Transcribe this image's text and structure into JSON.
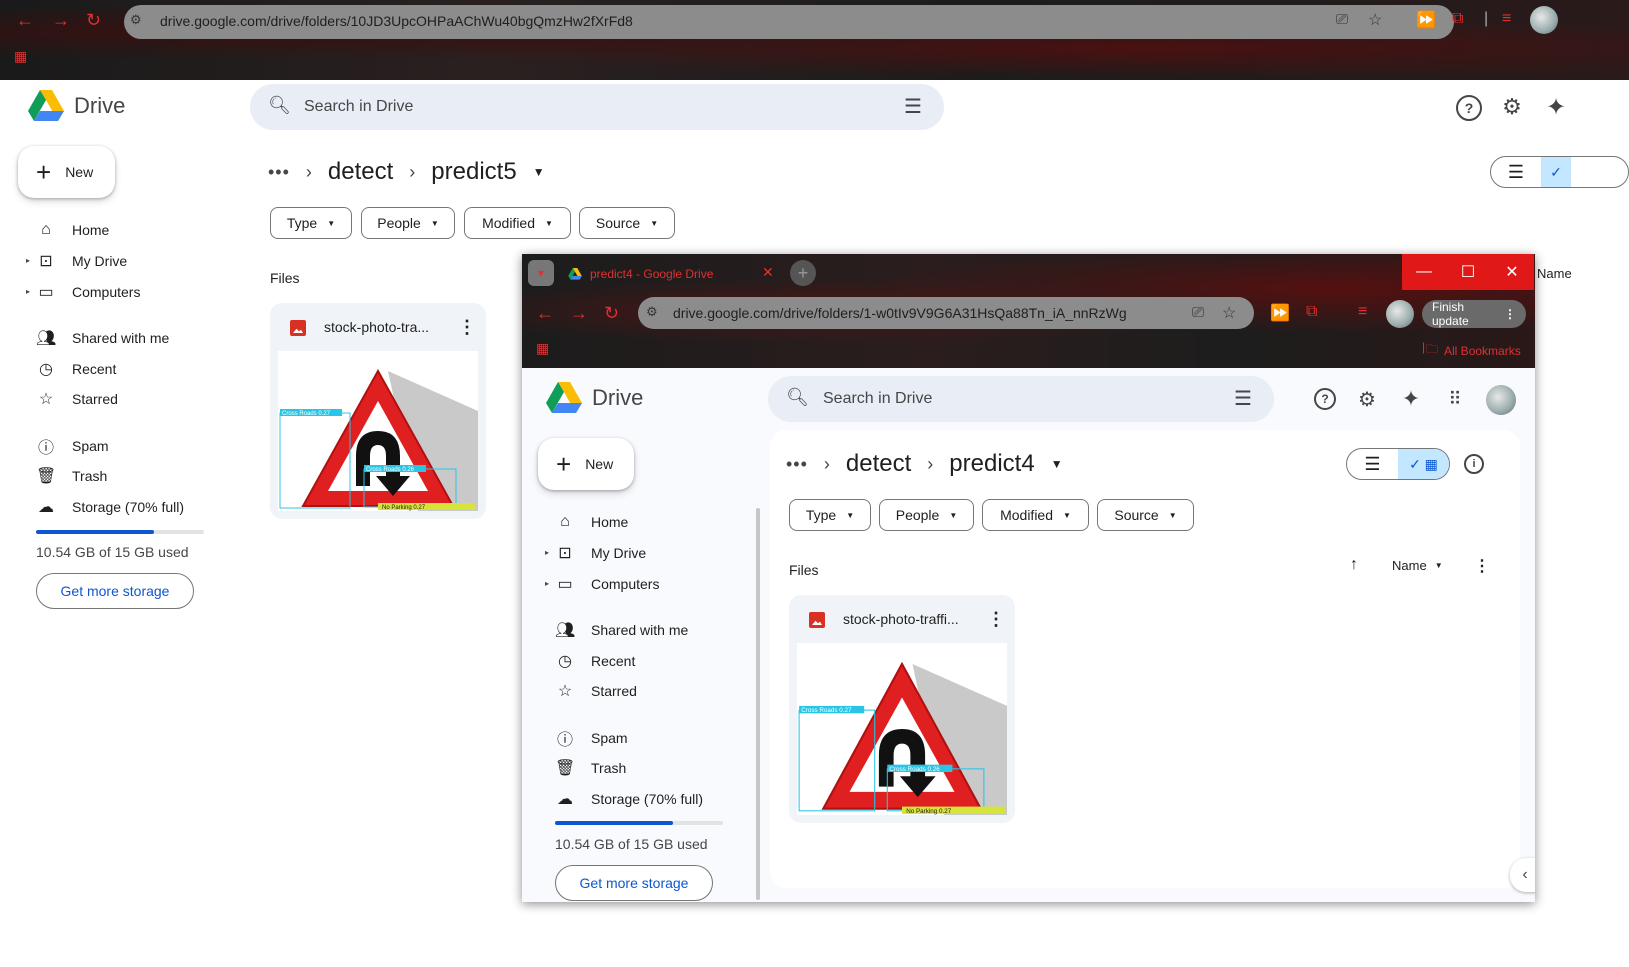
{
  "bg_browser": {
    "url": "drive.google.com/drive/folders/10JD3UpcOHPaAChWu40bgQmzHw2fXrFd8"
  },
  "bg_drive": {
    "app_name": "Drive",
    "search_placeholder": "Search in Drive",
    "new_label": "New",
    "nav": {
      "home": "Home",
      "my_drive": "My Drive",
      "computers": "Computers",
      "shared": "Shared with me",
      "recent": "Recent",
      "starred": "Starred",
      "spam": "Spam",
      "trash": "Trash",
      "storage": "Storage (70% full)"
    },
    "storage_used": "10.54 GB of 15 GB used",
    "storage_fraction": 0.7,
    "get_storage": "Get more storage",
    "breadcrumb": {
      "parent": "detect",
      "current": "predict5"
    },
    "filters": {
      "type": "Type",
      "people": "People",
      "modified": "Modified",
      "source": "Source"
    },
    "files_label": "Files",
    "file_name": "stock-photo-tra...",
    "name_header_partial": "Name"
  },
  "fg_browser": {
    "tab_title": "predict4 - Google Drive",
    "url": "drive.google.com/drive/folders/1-w0tIv9V9G6A31HsQa88Tn_iA_nnRzWg",
    "finish_update": "Finish update",
    "all_bookmarks": "All Bookmarks"
  },
  "fg_drive": {
    "app_name": "Drive",
    "search_placeholder": "Search in Drive",
    "new_label": "New",
    "nav": {
      "home": "Home",
      "my_drive": "My Drive",
      "computers": "Computers",
      "shared": "Shared with me",
      "recent": "Recent",
      "starred": "Starred",
      "spam": "Spam",
      "trash": "Trash",
      "storage": "Storage (70% full)"
    },
    "storage_used": "10.54 GB of 15 GB used",
    "storage_fraction": 0.7,
    "get_storage": "Get more storage",
    "breadcrumb": {
      "parent": "detect",
      "current": "predict4"
    },
    "filters": {
      "type": "Type",
      "people": "People",
      "modified": "Modified",
      "source": "Source"
    },
    "files_label": "Files",
    "sort_label": "Name",
    "file_name": "stock-photo-traffi..."
  },
  "detections": {
    "cross_roads": "Cross Roads 0.27",
    "cross_roads_2": "Cross Roads 0.26",
    "no_parking": "No Parking 0.27"
  },
  "colors": {
    "accent_blue": "#0b57d0",
    "search_bg": "#e9eef6",
    "window_red": "#e01818",
    "card_bg": "#f0f4f9"
  }
}
